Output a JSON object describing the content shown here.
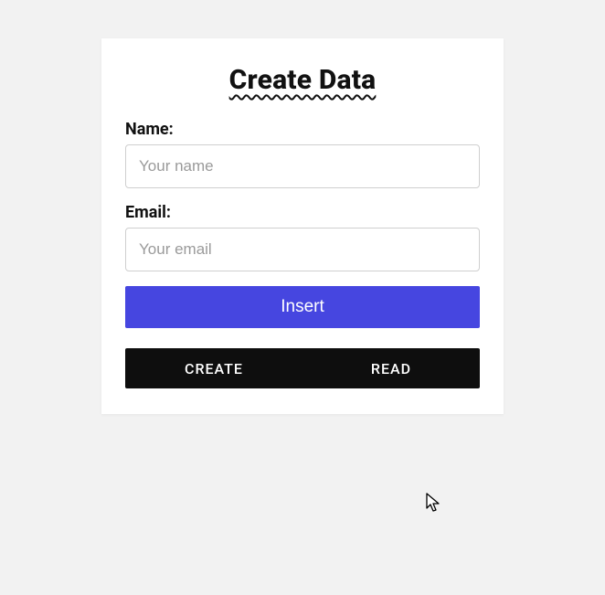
{
  "form": {
    "title": "Create Data",
    "name_label": "Name:",
    "name_placeholder": "Your name",
    "name_value": "",
    "email_label": "Email:",
    "email_placeholder": "Your email",
    "email_value": "",
    "submit_label": "Insert"
  },
  "nav": {
    "create_label": "CREATE",
    "read_label": "READ"
  }
}
